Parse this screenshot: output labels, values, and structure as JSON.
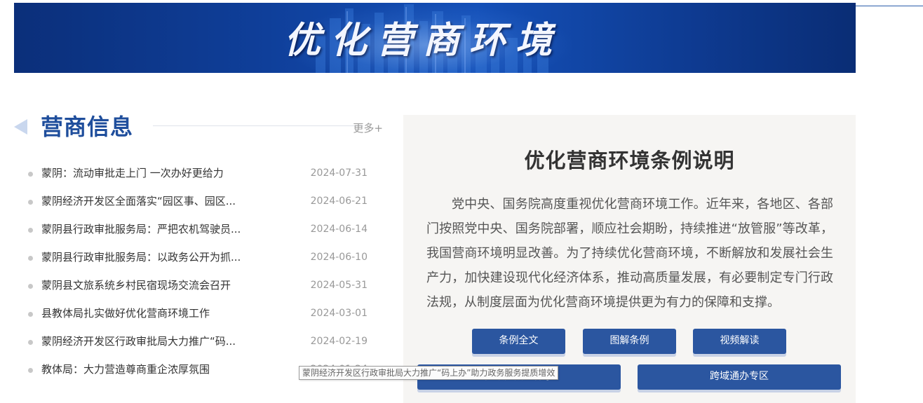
{
  "banner": {
    "title": "优化营商环境"
  },
  "news_section": {
    "title": "营商信息",
    "more_label": "更多+",
    "items": [
      {
        "title": "蒙阴：流动审批走上门 一次办好更给力",
        "date": "2024-07-31"
      },
      {
        "title": "蒙阴经济开发区全面落实“园区事、园区...",
        "date": "2024-06-21"
      },
      {
        "title": "蒙阴县行政审批服务局：严把农机驾驶员...",
        "date": "2024-06-14"
      },
      {
        "title": "蒙阴县行政审批服务局：以政务公开为抓...",
        "date": "2024-06-10"
      },
      {
        "title": "蒙阴县文旅系统乡村民宿现场交流会召开",
        "date": "2024-05-31"
      },
      {
        "title": "县教体局扎实做好优化营商环境工作",
        "date": "2024-03-01"
      },
      {
        "title": "蒙阴经济开发区行政审批局大力推广“码...",
        "date": "2024-02-19"
      },
      {
        "title": "教体局：大力营造尊商重企浓厚氛围",
        "date": "2024-01-24"
      }
    ],
    "tooltip": "蒙阴经济开发区行政审批局大力推广“码上办”助力政务服务提质增效"
  },
  "regulation_panel": {
    "title": "优化营商环境条例说明",
    "body": "党中央、国务院高度重视优化营商环境工作。近年来，各地区、各部门按照党中央、国务院部署，顺应社会期盼，持续推进“放管服”等改革，我国营商环境明显改善。为了持续优化营商环境，不断解放和发展社会生产力，加快建设现代化经济体系，推动高质量发展，有必要制定专门行政法规，从制度层面为优化营商环境提供更为有力的保障和支撑。",
    "buttons": {
      "full_text": "条例全文",
      "illustrated": "图解条例",
      "video": "视频解读",
      "one_thing": "高效办成一件事",
      "cross_region": "跨域通办专区"
    }
  },
  "colors": {
    "accent": "#2b56a0",
    "section_title": "#1f4e9c",
    "banner_bg": "#0f3f9a",
    "panel_bg": "#f6f5f3"
  }
}
